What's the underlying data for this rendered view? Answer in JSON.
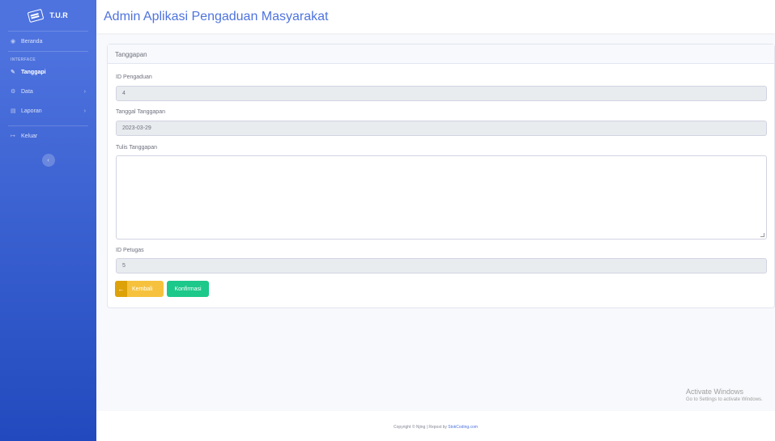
{
  "sidebar": {
    "brand": "T.U.R",
    "items": [
      {
        "label": "Beranda",
        "icon": "dashboard-icon"
      },
      {
        "label": "Tanggapi",
        "icon": "edit-icon"
      },
      {
        "label": "Data",
        "icon": "gear-icon"
      },
      {
        "label": "Laporan",
        "icon": "table-icon"
      },
      {
        "label": "Keluar",
        "icon": "logout-icon"
      }
    ],
    "heading_interface": "INTERFACE"
  },
  "header": {
    "title": "Admin Aplikasi Pengaduan Masyarakat"
  },
  "card": {
    "title": "Tanggapan",
    "id_pengaduan_label": "ID Pengaduan",
    "id_pengaduan_value": "4",
    "tanggal_label": "Tanggal Tanggapan",
    "tanggal_value": "2023-03-29",
    "tulis_label": "Tulis Tanggapan",
    "tulis_value": "",
    "id_petugas_label": "ID Petugas",
    "id_petugas_value": "5",
    "back_label": "Kembali",
    "confirm_label": "Konfirmasi"
  },
  "watermark": {
    "line1": "Activate Windows",
    "line2": "Go to Settings to activate Windows."
  },
  "footer": {
    "text": "Copyright © Njing | Repost by",
    "link": "StokCoding.com"
  },
  "colors": {
    "primary": "#4e73df",
    "warning": "#f6c23e",
    "success": "#1cc88a"
  }
}
